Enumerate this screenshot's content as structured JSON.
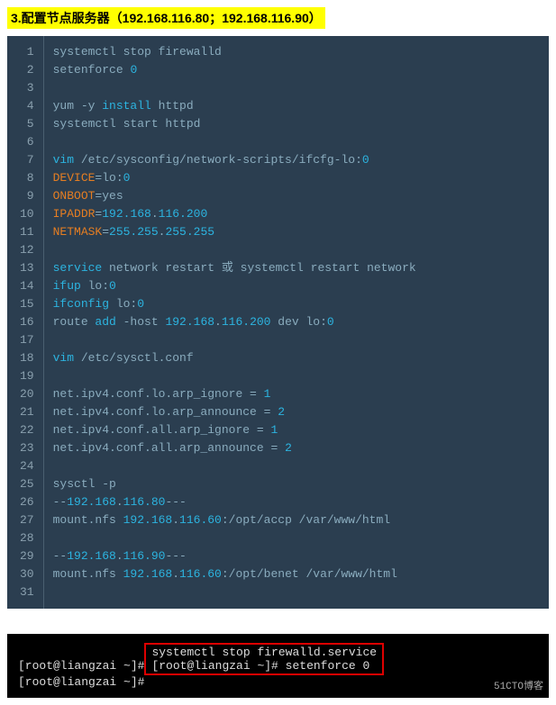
{
  "heading": "3.配置节点服务器（192.168.116.80；192.168.116.90）",
  "code": {
    "lines": [
      [
        {
          "t": "systemctl stop firewalld",
          "c": "dim"
        }
      ],
      [
        {
          "t": "setenforce ",
          "c": "dim"
        },
        {
          "t": "0",
          "c": "num"
        }
      ],
      [],
      [
        {
          "t": "yum -y ",
          "c": "dim"
        },
        {
          "t": "install",
          "c": "kw"
        },
        {
          "t": " httpd",
          "c": "dim"
        }
      ],
      [
        {
          "t": "systemctl start httpd",
          "c": "dim"
        }
      ],
      [],
      [
        {
          "t": "vim",
          "c": "kw"
        },
        {
          "t": " /etc/sysconfig/network-scripts/ifcfg-lo:",
          "c": "dim"
        },
        {
          "t": "0",
          "c": "num"
        }
      ],
      [
        {
          "t": "DEVICE",
          "c": "var"
        },
        {
          "t": "=lo:",
          "c": "dim"
        },
        {
          "t": "0",
          "c": "num"
        }
      ],
      [
        {
          "t": "ONBOOT",
          "c": "var"
        },
        {
          "t": "=yes",
          "c": "dim"
        }
      ],
      [
        {
          "t": "IPADDR",
          "c": "var"
        },
        {
          "t": "=",
          "c": "dim"
        },
        {
          "t": "192.168",
          "c": "num"
        },
        {
          "t": ".",
          "c": "dim"
        },
        {
          "t": "116.200",
          "c": "num"
        }
      ],
      [
        {
          "t": "NETMASK",
          "c": "var"
        },
        {
          "t": "=",
          "c": "dim"
        },
        {
          "t": "255.255",
          "c": "num"
        },
        {
          "t": ".",
          "c": "dim"
        },
        {
          "t": "255.255",
          "c": "num"
        }
      ],
      [],
      [
        {
          "t": "service",
          "c": "kw"
        },
        {
          "t": " network restart 或 systemctl restart network",
          "c": "dim"
        }
      ],
      [
        {
          "t": "ifup",
          "c": "kw"
        },
        {
          "t": " lo:",
          "c": "dim"
        },
        {
          "t": "0",
          "c": "num"
        }
      ],
      [
        {
          "t": "ifconfig",
          "c": "kw"
        },
        {
          "t": " lo:",
          "c": "dim"
        },
        {
          "t": "0",
          "c": "num"
        }
      ],
      [
        {
          "t": "route ",
          "c": "dim"
        },
        {
          "t": "add",
          "c": "kw"
        },
        {
          "t": " -host ",
          "c": "dim"
        },
        {
          "t": "192.168",
          "c": "num"
        },
        {
          "t": ".",
          "c": "dim"
        },
        {
          "t": "116.200",
          "c": "num"
        },
        {
          "t": " dev lo:",
          "c": "dim"
        },
        {
          "t": "0",
          "c": "num"
        }
      ],
      [],
      [
        {
          "t": "vim",
          "c": "kw"
        },
        {
          "t": " /etc/sysctl.conf",
          "c": "dim"
        }
      ],
      [],
      [
        {
          "t": "net.ipv4.conf.lo.arp_ignore = ",
          "c": "dim"
        },
        {
          "t": "1",
          "c": "num"
        }
      ],
      [
        {
          "t": "net.ipv4.conf.lo.arp_announce = ",
          "c": "dim"
        },
        {
          "t": "2",
          "c": "num"
        }
      ],
      [
        {
          "t": "net.ipv4.conf.all.arp_ignore = ",
          "c": "dim"
        },
        {
          "t": "1",
          "c": "num"
        }
      ],
      [
        {
          "t": "net.ipv4.conf.all.arp_announce = ",
          "c": "dim"
        },
        {
          "t": "2",
          "c": "num"
        }
      ],
      [],
      [
        {
          "t": "sysctl -p",
          "c": "dim"
        }
      ],
      [
        {
          "t": "--",
          "c": "dim"
        },
        {
          "t": "192.168",
          "c": "num"
        },
        {
          "t": ".",
          "c": "dim"
        },
        {
          "t": "116.80",
          "c": "num"
        },
        {
          "t": "---",
          "c": "dim"
        }
      ],
      [
        {
          "t": "mount.nfs ",
          "c": "dim"
        },
        {
          "t": "192.168",
          "c": "num"
        },
        {
          "t": ".",
          "c": "dim"
        },
        {
          "t": "116.60",
          "c": "num"
        },
        {
          "t": ":/opt/accp /var/www/html",
          "c": "dim"
        }
      ],
      [],
      [
        {
          "t": "--",
          "c": "dim"
        },
        {
          "t": "192.168",
          "c": "num"
        },
        {
          "t": ".",
          "c": "dim"
        },
        {
          "t": "116.90",
          "c": "num"
        },
        {
          "t": "---",
          "c": "dim"
        }
      ],
      [
        {
          "t": "mount.nfs ",
          "c": "dim"
        },
        {
          "t": "192.168",
          "c": "num"
        },
        {
          "t": ".",
          "c": "dim"
        },
        {
          "t": "116.60",
          "c": "num"
        },
        {
          "t": ":/opt/benet /var/www/html",
          "c": "dim"
        }
      ],
      []
    ]
  },
  "terminal": {
    "line1_prompt": "[root@liangzai ~]#",
    "line1_cmd": " systemctl stop firewalld.service",
    "line2_prompt": "[root@liangzai ~]#",
    "line2_cmd": " setenforce 0",
    "line3_prompt": "[root@liangzai ~]#"
  },
  "watermark": "51CTO博客"
}
